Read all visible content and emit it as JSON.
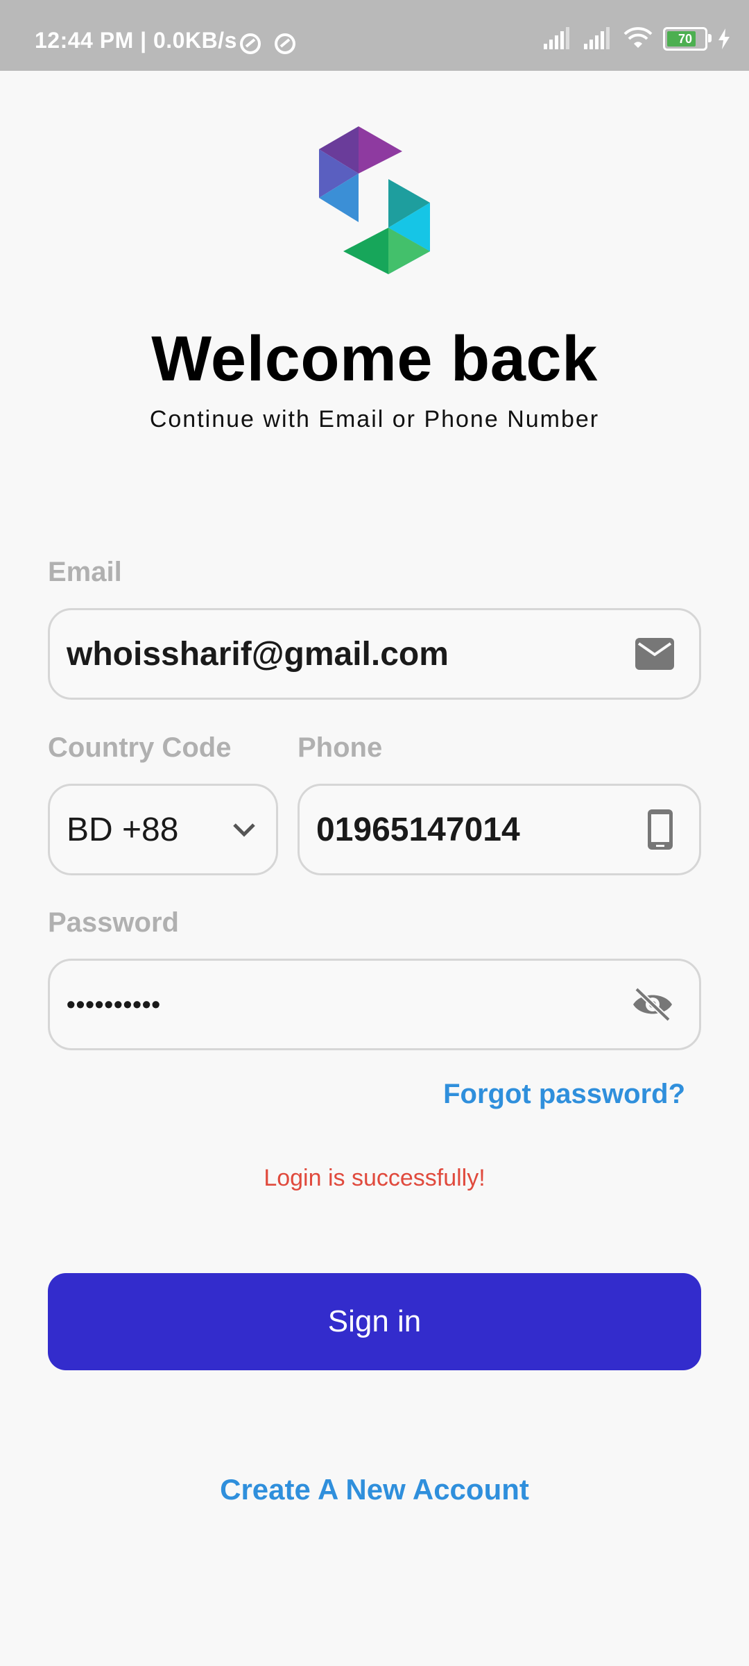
{
  "status_bar": {
    "time_speed": "12:44 PM | 0.0KB/s",
    "battery": "70"
  },
  "header": {
    "title": "Welcome back",
    "subtitle": "Continue with Email or Phone Number"
  },
  "form": {
    "email_label": "Email",
    "email_value": "whoissharif@gmail.com",
    "country_code_label": "Country Code",
    "country_code_value": "BD +88",
    "phone_label": "Phone",
    "phone_value": "01965147014",
    "password_label": "Password",
    "password_value": "••••••••••",
    "forgot_password": "Forgot password?",
    "status_message": "Login is successfully!"
  },
  "actions": {
    "sign_in": "Sign in",
    "create_account": "Create A New Account"
  },
  "colors": {
    "primary_button": "#332ccc",
    "link": "#2f8fdc",
    "success_message": "#e04a3d"
  }
}
